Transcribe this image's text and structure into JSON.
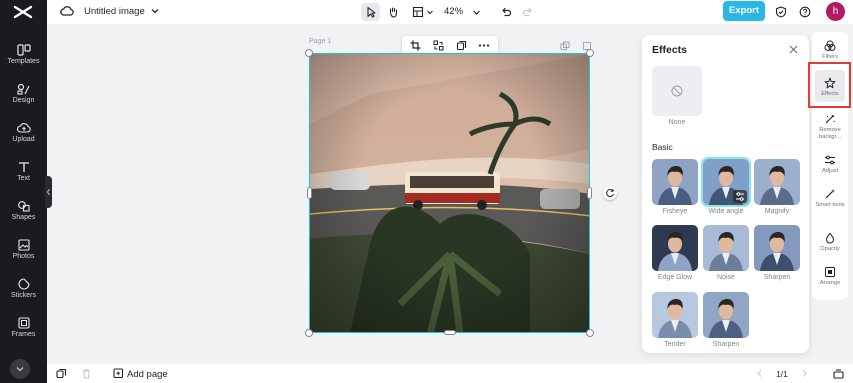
{
  "header": {
    "doc_title": "Untitled image",
    "zoom": "42%",
    "export_label": "Export",
    "avatar_initial": "h"
  },
  "sidebar": {
    "items": [
      {
        "label": "Templates",
        "icon": "templates-icon"
      },
      {
        "label": "Design",
        "icon": "design-icon"
      },
      {
        "label": "Upload",
        "icon": "upload-icon"
      },
      {
        "label": "Text",
        "icon": "text-icon"
      },
      {
        "label": "Shapes",
        "icon": "shapes-icon"
      },
      {
        "label": "Photos",
        "icon": "photos-icon"
      },
      {
        "label": "Stickers",
        "icon": "stickers-icon"
      },
      {
        "label": "Frames",
        "icon": "frames-icon"
      }
    ]
  },
  "canvas": {
    "page_label": "Page 1"
  },
  "effects_panel": {
    "title": "Effects",
    "none_label": "None",
    "section_title": "Basic",
    "effects": [
      {
        "label": "Fisheye",
        "selected": false
      },
      {
        "label": "Wide angle",
        "selected": true
      },
      {
        "label": "Magnify",
        "selected": false
      },
      {
        "label": "Edge Glow",
        "selected": false
      },
      {
        "label": "Noise",
        "selected": false
      },
      {
        "label": "Sharpen",
        "selected": false
      },
      {
        "label": "Tender",
        "selected": false
      },
      {
        "label": "Sharpen",
        "selected": false
      }
    ]
  },
  "right_rail": {
    "items": [
      {
        "label": "Filters",
        "icon": "filters-icon"
      },
      {
        "label": "Effects",
        "icon": "effects-icon",
        "active": true
      },
      {
        "label": "Remove backgr...",
        "icon": "remove-background-icon"
      },
      {
        "label": "Adjust",
        "icon": "adjust-icon"
      },
      {
        "label": "Smart tools",
        "icon": "smart-tools-icon"
      },
      {
        "label": "Opacity",
        "icon": "opacity-icon"
      },
      {
        "label": "Arrange",
        "icon": "arrange-icon"
      }
    ]
  },
  "footer": {
    "add_page_label": "Add page",
    "page_indicator": "1/1"
  },
  "colors": {
    "accent": "#2bb7e6",
    "sidebar_bg": "#1b1b1f",
    "selection": "#21c3d6",
    "highlight": "#e53935",
    "avatar": "#b01b62"
  }
}
